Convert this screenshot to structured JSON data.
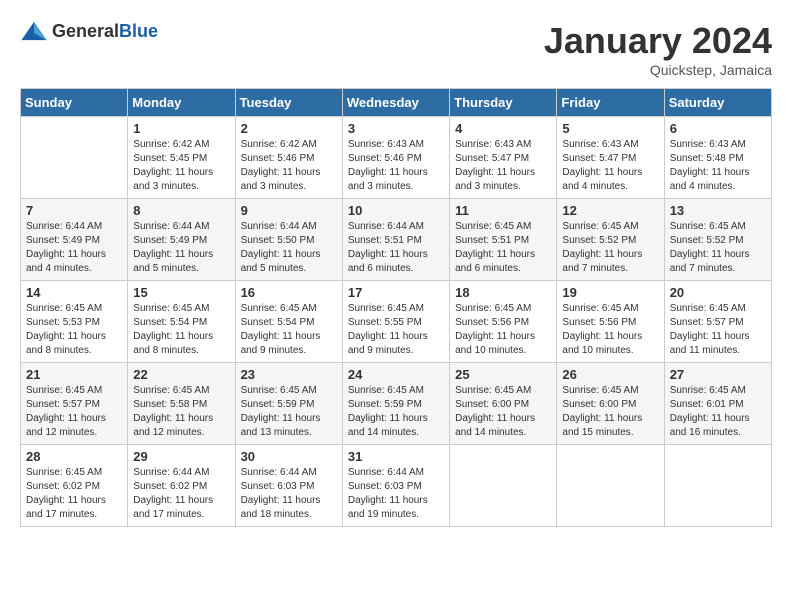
{
  "header": {
    "logo_general": "General",
    "logo_blue": "Blue",
    "month_year": "January 2024",
    "location": "Quickstep, Jamaica"
  },
  "days_of_week": [
    "Sunday",
    "Monday",
    "Tuesday",
    "Wednesday",
    "Thursday",
    "Friday",
    "Saturday"
  ],
  "weeks": [
    [
      {
        "day": "",
        "info": ""
      },
      {
        "day": "1",
        "info": "Sunrise: 6:42 AM\nSunset: 5:45 PM\nDaylight: 11 hours\nand 3 minutes."
      },
      {
        "day": "2",
        "info": "Sunrise: 6:42 AM\nSunset: 5:46 PM\nDaylight: 11 hours\nand 3 minutes."
      },
      {
        "day": "3",
        "info": "Sunrise: 6:43 AM\nSunset: 5:46 PM\nDaylight: 11 hours\nand 3 minutes."
      },
      {
        "day": "4",
        "info": "Sunrise: 6:43 AM\nSunset: 5:47 PM\nDaylight: 11 hours\nand 3 minutes."
      },
      {
        "day": "5",
        "info": "Sunrise: 6:43 AM\nSunset: 5:47 PM\nDaylight: 11 hours\nand 4 minutes."
      },
      {
        "day": "6",
        "info": "Sunrise: 6:43 AM\nSunset: 5:48 PM\nDaylight: 11 hours\nand 4 minutes."
      }
    ],
    [
      {
        "day": "7",
        "info": "Sunrise: 6:44 AM\nSunset: 5:49 PM\nDaylight: 11 hours\nand 4 minutes."
      },
      {
        "day": "8",
        "info": "Sunrise: 6:44 AM\nSunset: 5:49 PM\nDaylight: 11 hours\nand 5 minutes."
      },
      {
        "day": "9",
        "info": "Sunrise: 6:44 AM\nSunset: 5:50 PM\nDaylight: 11 hours\nand 5 minutes."
      },
      {
        "day": "10",
        "info": "Sunrise: 6:44 AM\nSunset: 5:51 PM\nDaylight: 11 hours\nand 6 minutes."
      },
      {
        "day": "11",
        "info": "Sunrise: 6:45 AM\nSunset: 5:51 PM\nDaylight: 11 hours\nand 6 minutes."
      },
      {
        "day": "12",
        "info": "Sunrise: 6:45 AM\nSunset: 5:52 PM\nDaylight: 11 hours\nand 7 minutes."
      },
      {
        "day": "13",
        "info": "Sunrise: 6:45 AM\nSunset: 5:52 PM\nDaylight: 11 hours\nand 7 minutes."
      }
    ],
    [
      {
        "day": "14",
        "info": "Sunrise: 6:45 AM\nSunset: 5:53 PM\nDaylight: 11 hours\nand 8 minutes."
      },
      {
        "day": "15",
        "info": "Sunrise: 6:45 AM\nSunset: 5:54 PM\nDaylight: 11 hours\nand 8 minutes."
      },
      {
        "day": "16",
        "info": "Sunrise: 6:45 AM\nSunset: 5:54 PM\nDaylight: 11 hours\nand 9 minutes."
      },
      {
        "day": "17",
        "info": "Sunrise: 6:45 AM\nSunset: 5:55 PM\nDaylight: 11 hours\nand 9 minutes."
      },
      {
        "day": "18",
        "info": "Sunrise: 6:45 AM\nSunset: 5:56 PM\nDaylight: 11 hours\nand 10 minutes."
      },
      {
        "day": "19",
        "info": "Sunrise: 6:45 AM\nSunset: 5:56 PM\nDaylight: 11 hours\nand 10 minutes."
      },
      {
        "day": "20",
        "info": "Sunrise: 6:45 AM\nSunset: 5:57 PM\nDaylight: 11 hours\nand 11 minutes."
      }
    ],
    [
      {
        "day": "21",
        "info": "Sunrise: 6:45 AM\nSunset: 5:57 PM\nDaylight: 11 hours\nand 12 minutes."
      },
      {
        "day": "22",
        "info": "Sunrise: 6:45 AM\nSunset: 5:58 PM\nDaylight: 11 hours\nand 12 minutes."
      },
      {
        "day": "23",
        "info": "Sunrise: 6:45 AM\nSunset: 5:59 PM\nDaylight: 11 hours\nand 13 minutes."
      },
      {
        "day": "24",
        "info": "Sunrise: 6:45 AM\nSunset: 5:59 PM\nDaylight: 11 hours\nand 14 minutes."
      },
      {
        "day": "25",
        "info": "Sunrise: 6:45 AM\nSunset: 6:00 PM\nDaylight: 11 hours\nand 14 minutes."
      },
      {
        "day": "26",
        "info": "Sunrise: 6:45 AM\nSunset: 6:00 PM\nDaylight: 11 hours\nand 15 minutes."
      },
      {
        "day": "27",
        "info": "Sunrise: 6:45 AM\nSunset: 6:01 PM\nDaylight: 11 hours\nand 16 minutes."
      }
    ],
    [
      {
        "day": "28",
        "info": "Sunrise: 6:45 AM\nSunset: 6:02 PM\nDaylight: 11 hours\nand 17 minutes."
      },
      {
        "day": "29",
        "info": "Sunrise: 6:44 AM\nSunset: 6:02 PM\nDaylight: 11 hours\nand 17 minutes."
      },
      {
        "day": "30",
        "info": "Sunrise: 6:44 AM\nSunset: 6:03 PM\nDaylight: 11 hours\nand 18 minutes."
      },
      {
        "day": "31",
        "info": "Sunrise: 6:44 AM\nSunset: 6:03 PM\nDaylight: 11 hours\nand 19 minutes."
      },
      {
        "day": "",
        "info": ""
      },
      {
        "day": "",
        "info": ""
      },
      {
        "day": "",
        "info": ""
      }
    ]
  ]
}
